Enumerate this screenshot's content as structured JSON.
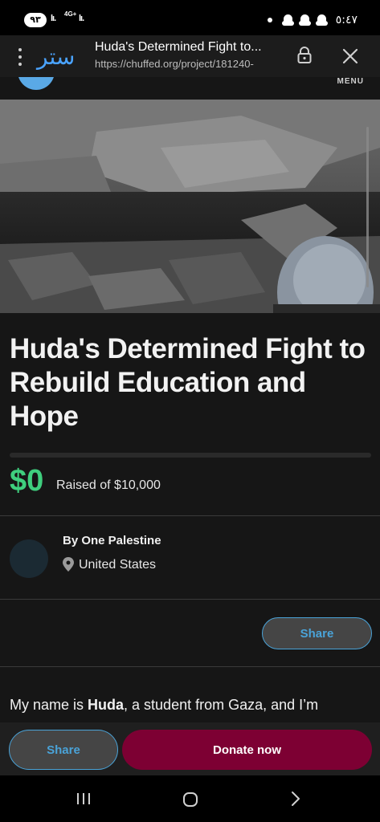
{
  "status_bar": {
    "battery": "٩٣",
    "net_type": "4G+",
    "clock": "٥:٤٧"
  },
  "browser": {
    "logo_text": "ستر",
    "page_title": "Huda's Determined Fight to...",
    "url": "https://chuffed.org/project/181240-"
  },
  "site": {
    "menu_label": "MENU"
  },
  "project": {
    "title": "Huda's Determined Fight to Rebuild Education and Hope",
    "raised_amount": "$0",
    "raised_text": "Raised of $10,000",
    "progress_fraction": 0,
    "organizer": "By One Palestine",
    "location": "United States",
    "share_label": "Share",
    "body_start": "My name is ",
    "body_name": "Huda",
    "body_rest": ", a student from Gaza, and I’m"
  },
  "bottom_bar": {
    "share_label": "Share",
    "donate_label": "Donate now"
  },
  "colors": {
    "accent_green": "#3fcf7e",
    "share_blue": "#4aa3d8",
    "donate": "#7d0033",
    "background": "#161616"
  }
}
